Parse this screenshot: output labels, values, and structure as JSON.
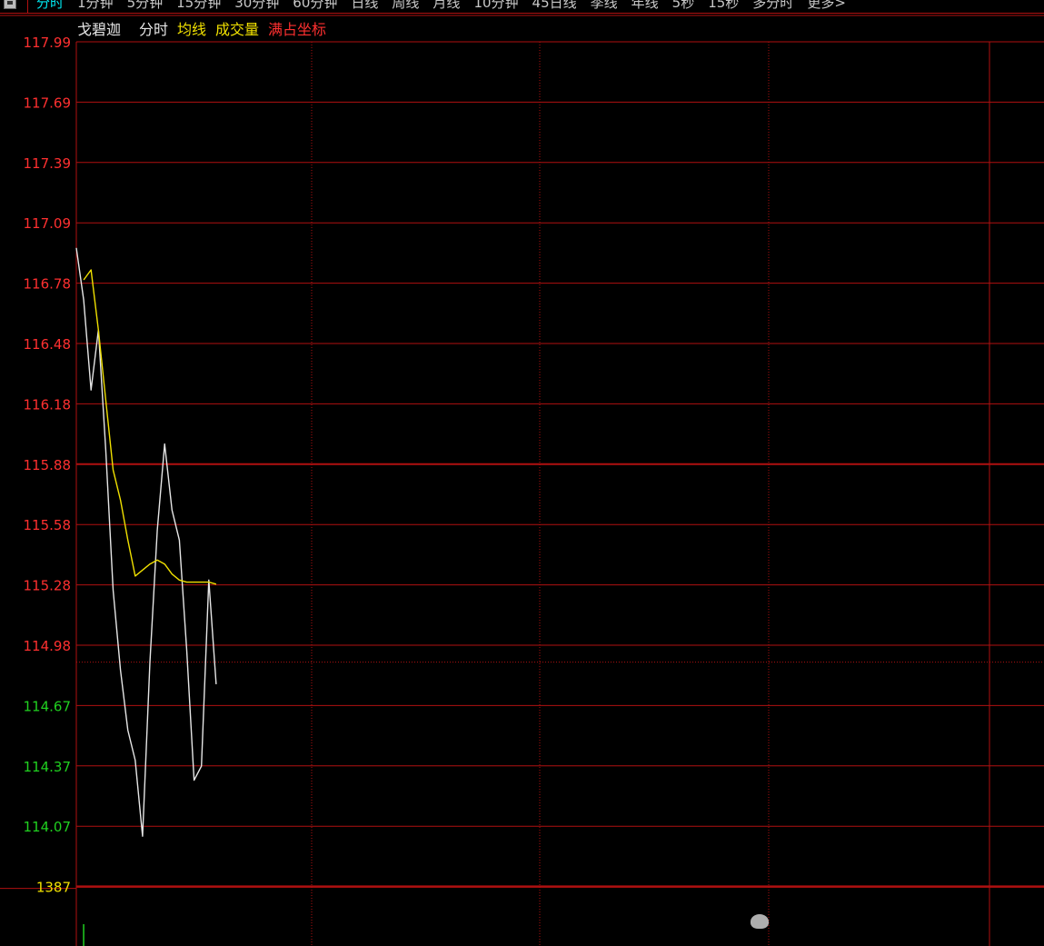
{
  "toolbar": {
    "tabs": [
      "分时",
      "1分钟",
      "5分钟",
      "15分钟",
      "30分钟",
      "60分钟",
      "日线",
      "周线",
      "月线",
      "10分钟",
      "45日线",
      "季线",
      "年线",
      "5秒",
      "15秒",
      "多分时",
      "更多>"
    ],
    "active_tab": "分时"
  },
  "legend": {
    "stock_name": "戈碧迦",
    "items": [
      {
        "label": "分时",
        "color": "#e6e6e6"
      },
      {
        "label": "均线",
        "color": "#f0e000"
      },
      {
        "label": "成交量",
        "color": "#f0e000"
      },
      {
        "label": "满占坐标",
        "color": "#ff3030"
      }
    ]
  },
  "colors": {
    "grid": "#b01010",
    "up": "#ff3030",
    "down": "#20d020",
    "price_line": "#e6e6e6",
    "avg_line": "#f0e000",
    "volume_label": "#f0e000"
  },
  "chart_data": {
    "type": "line",
    "y_ticks": [
      {
        "label": "117.99",
        "color": "up"
      },
      {
        "label": "117.69",
        "color": "up"
      },
      {
        "label": "117.39",
        "color": "up"
      },
      {
        "label": "117.09",
        "color": "up"
      },
      {
        "label": "116.78",
        "color": "up"
      },
      {
        "label": "116.48",
        "color": "up"
      },
      {
        "label": "116.18",
        "color": "up"
      },
      {
        "label": "115.88",
        "color": "up"
      },
      {
        "label": "115.58",
        "color": "up"
      },
      {
        "label": "115.28",
        "color": "up"
      },
      {
        "label": "114.98",
        "color": "up"
      },
      {
        "label": "114.67",
        "color": "down"
      },
      {
        "label": "114.37",
        "color": "down"
      },
      {
        "label": "114.07",
        "color": "down"
      }
    ],
    "ylim": [
      114.07,
      117.99
    ],
    "prev_close": 114.89,
    "volume_tick": "1387",
    "series": [
      {
        "name": "分时",
        "x": [
          0,
          2,
          4,
          6,
          8,
          10,
          12,
          14,
          16,
          18,
          20,
          22,
          24,
          26,
          28,
          30,
          32,
          34,
          36,
          38
        ],
        "values": [
          116.96,
          116.7,
          116.25,
          116.55,
          115.95,
          115.25,
          114.85,
          114.55,
          114.4,
          114.02,
          114.89,
          115.55,
          115.98,
          115.65,
          115.5,
          114.95,
          114.3,
          114.37,
          115.3,
          114.78
        ]
      },
      {
        "name": "均线",
        "x": [
          2,
          4,
          6,
          8,
          10,
          12,
          14,
          16,
          18,
          20,
          22,
          24,
          26,
          28,
          30,
          32,
          34,
          36,
          38
        ],
        "values": [
          116.8,
          116.85,
          116.55,
          116.2,
          115.85,
          115.7,
          115.5,
          115.32,
          115.35,
          115.38,
          115.4,
          115.38,
          115.33,
          115.3,
          115.29,
          115.29,
          115.29,
          115.29,
          115.28
        ]
      }
    ],
    "volume": [
      {
        "x": 1,
        "value": 0.4
      }
    ]
  }
}
